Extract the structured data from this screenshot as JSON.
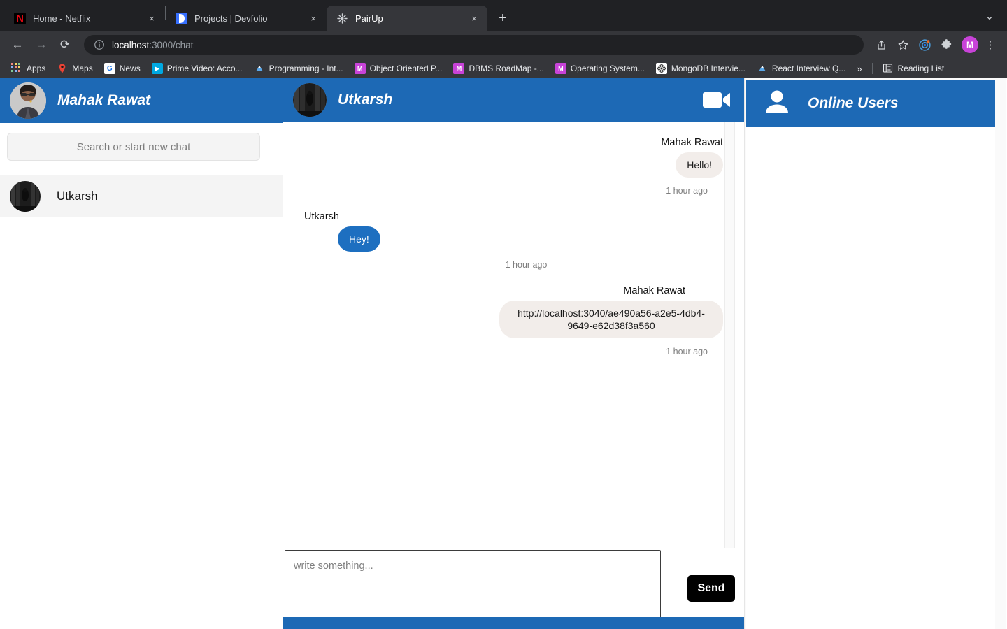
{
  "browser": {
    "tabs": [
      {
        "title": "Home - Netflix",
        "favicon": "netflix-icon",
        "active": false,
        "close_label": "×"
      },
      {
        "title": "Projects | Devfolio",
        "favicon": "devfolio-icon",
        "active": false,
        "close_label": "×"
      },
      {
        "title": "PairUp",
        "favicon": "spinner-icon",
        "active": true,
        "close_label": "×"
      }
    ],
    "new_tab_label": "+",
    "window_chevron": "⌄",
    "nav": {
      "back": "←",
      "forward": "→",
      "reload": "⟳"
    },
    "omnibox": {
      "info_icon": "info-circle-icon",
      "url_host": "localhost",
      "url_path": ":3000/chat"
    },
    "toolbar_icons": [
      {
        "name": "share-icon",
        "glyph": "⇧"
      },
      {
        "name": "bookmark-star-icon",
        "glyph": "☆"
      },
      {
        "name": "extension-target-icon",
        "glyph": "◎"
      },
      {
        "name": "puzzle-extensions-icon",
        "glyph": "✦"
      }
    ],
    "profile_initial": "M",
    "menu_glyph": "⋮",
    "bookmarks": [
      {
        "label": "Apps",
        "icon": "apps-grid-icon"
      },
      {
        "label": "Maps",
        "icon": "maps-pin-icon"
      },
      {
        "label": "News",
        "icon": "google-news-icon"
      },
      {
        "label": "Prime Video: Acco...",
        "icon": "prime-video-icon"
      },
      {
        "label": "Programming - Int...",
        "icon": "mountain-icon"
      },
      {
        "label": "Object Oriented P...",
        "icon": "medium-icon"
      },
      {
        "label": "DBMS RoadMap -...",
        "icon": "medium-icon"
      },
      {
        "label": "Operating System...",
        "icon": "medium-icon"
      },
      {
        "label": "MongoDB Intervie...",
        "icon": "mongodb-icon"
      },
      {
        "label": "React Interview Q...",
        "icon": "mountain-icon"
      }
    ],
    "bookmarks_overflow": "»",
    "reading_list": {
      "label": "Reading List",
      "icon": "reading-list-icon"
    }
  },
  "sidebar": {
    "user_name": "Mahak Rawat",
    "avatar_name": "user-avatar",
    "search_placeholder": "Search or start new chat",
    "search_value": "",
    "chats": [
      {
        "name": "Utkarsh",
        "avatar_name": "contact-avatar"
      }
    ]
  },
  "chat": {
    "contact_name": "Utkarsh",
    "video_call_icon": "video-camera-icon",
    "messages": [
      {
        "author": "Mahak Rawat",
        "text": "Hello!",
        "time": "1 hour ago",
        "side": "right"
      },
      {
        "author": "Utkarsh",
        "text": "Hey!",
        "time": "1 hour ago",
        "side": "left"
      },
      {
        "author": "Mahak Rawat",
        "text": "http://localhost:3040/ae490a56-a2e5-4db4-9649-e62d38f3a560",
        "time": "1 hour ago",
        "side": "right"
      }
    ],
    "composer": {
      "placeholder": "write something...",
      "value": "",
      "send_label": "Send"
    }
  },
  "online_panel": {
    "title": "Online Users",
    "icon": "person-icon",
    "users": []
  },
  "colors": {
    "brand_blue": "#1d69b5",
    "bubble_me": "#f2edea",
    "bubble_them": "#1d6fc0",
    "send_button": "#000000"
  }
}
